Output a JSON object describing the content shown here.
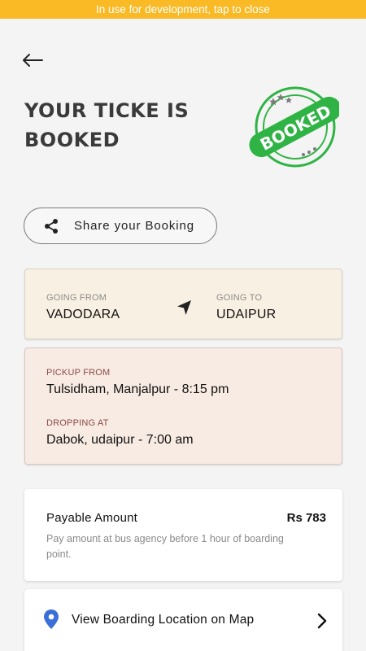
{
  "dev_banner": "In use for development, tap to close",
  "page_title": "YOUR TICKE IS BOOKED",
  "stamp": {
    "text": "BOOKED",
    "color": "#2fb344"
  },
  "share": {
    "label": "Share your Booking",
    "icon": "share-icon"
  },
  "route": {
    "from_label": "GOING FROM",
    "from_value": "VADODARA",
    "to_label": "GOING TO",
    "to_value": "UDAIPUR",
    "icon": "navigation-arrow-icon"
  },
  "pickup": {
    "pickup_label": "PICKUP FROM",
    "pickup_value": "Tulsidham, Manjalpur - 8:15 pm",
    "drop_label": "DROPPING AT",
    "drop_value": "Dabok, udaipur - 7:00 am"
  },
  "payment": {
    "title": "Payable Amount",
    "amount": "Rs 783",
    "note": "Pay amount at bus agency before 1 hour of boarding point."
  },
  "map": {
    "label": "View Boarding Location on Map",
    "faded_text": "",
    "icon": "location-pin-icon",
    "pin_color": "#3b6fd8"
  }
}
